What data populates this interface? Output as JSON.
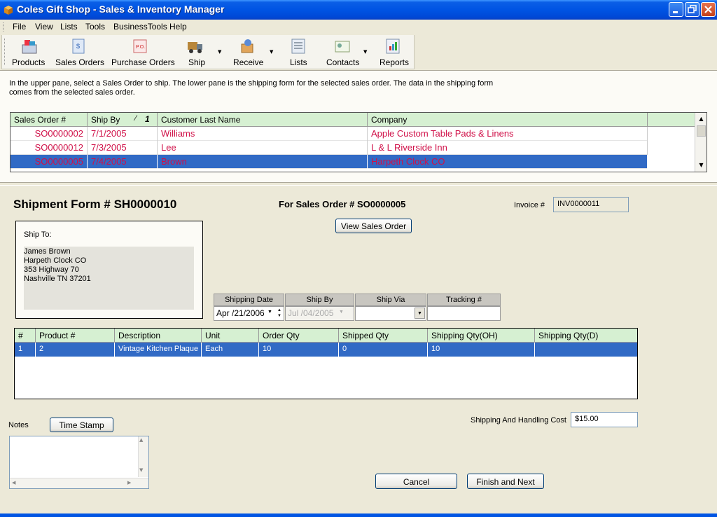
{
  "window": {
    "title": "Coles Gift Shop - Sales & Inventory Manager"
  },
  "menu": [
    "File",
    "View",
    "Lists",
    "Tools",
    "BusinessTools",
    "Help"
  ],
  "toolbar": [
    {
      "label": "Products",
      "icon": "products-icon"
    },
    {
      "label": "Sales Orders",
      "icon": "sales-orders-icon"
    },
    {
      "label": "Purchase Orders",
      "icon": "purchase-orders-icon"
    },
    {
      "label": "Ship",
      "icon": "ship-truck-icon"
    },
    {
      "label": "Receive",
      "icon": "receive-box-icon"
    },
    {
      "label": "Lists",
      "icon": "lists-icon"
    },
    {
      "label": "Contacts",
      "icon": "contacts-icon"
    },
    {
      "label": "Reports",
      "icon": "reports-icon"
    }
  ],
  "upper": {
    "instructions": "In the upper pane, select a Sales Order to ship. The lower pane is the shipping form for the selected sales order. The data in the shipping form comes from the selected sales order.",
    "columns": [
      "Sales Order #",
      "Ship By",
      "Customer Last Name",
      "Company"
    ],
    "sort_indicator": "1",
    "rows": [
      {
        "so": "SO0000002",
        "ship_by": "7/1/2005",
        "last_name": "Williams",
        "company": "Apple Custom Table Pads & Linens",
        "selected": false
      },
      {
        "so": "SO0000012",
        "ship_by": "7/3/2005",
        "last_name": "Lee",
        "company": "L & L Riverside Inn",
        "selected": false
      },
      {
        "so": "SO0000005",
        "ship_by": "7/4/2005",
        "last_name": "Brown",
        "company": "Harpeth Clock CO",
        "selected": true
      }
    ]
  },
  "form": {
    "shipment_title": "Shipment Form # SH0000010",
    "sales_order_title": "For Sales Order # SO0000005",
    "invoice_label": "Invoice #",
    "invoice_value": "INV0000011",
    "view_so_button": "View Sales Order",
    "ship_to_label": "Ship To:",
    "ship_to_lines": [
      "James  Brown",
      "Harpeth Clock CO",
      "353 Highway 70",
      "Nashville  TN  37201"
    ],
    "shipping": {
      "headers": [
        "Shipping Date",
        "Ship By",
        "Ship Via",
        "Tracking #"
      ],
      "shipping_date": "Apr /21/2006",
      "ship_by": "Jul /04/2005",
      "ship_via": "",
      "tracking": ""
    },
    "product_columns": [
      "#",
      "Product #",
      "Description",
      "Unit",
      "Order Qty",
      "Shipped Qty",
      "Shipping Qty(OH)",
      "Shipping Qty(D)"
    ],
    "product_rows": [
      {
        "num": "1",
        "product": "2",
        "description": "Vintage Kitchen Plaque",
        "unit": "Each",
        "order_qty": "10",
        "shipped_qty": "0",
        "ship_oh": "10",
        "ship_d": ""
      }
    ],
    "notes_label": "Notes",
    "timestamp_button": "Time Stamp",
    "cost_label": "Shipping And Handling Cost",
    "cost_value": "$15.00",
    "cancel_button": "Cancel",
    "finish_button": "Finish and Next"
  },
  "colors": {
    "titlebar": "#0054e3",
    "selection": "#316ac5",
    "grid_header": "#d6f0d2",
    "row_text": "#d01048"
  }
}
